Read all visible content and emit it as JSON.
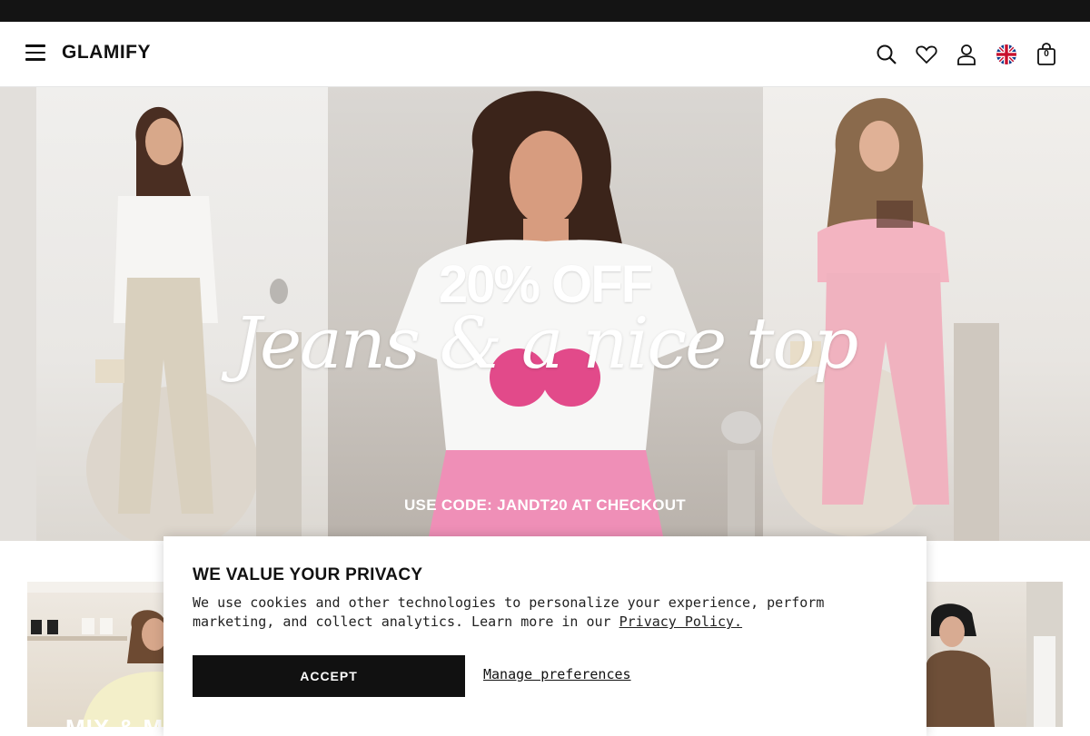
{
  "brand": {
    "name": "GLAMIFY"
  },
  "header": {
    "icons": [
      "menu-icon",
      "search-icon",
      "heart-icon",
      "user-icon",
      "uk-flag-icon",
      "bag-icon"
    ],
    "bag_count": "0"
  },
  "hero": {
    "discount": "20% OFF",
    "headline": "Jeans & a nice top",
    "code_text": "USE CODE: JANDT20 AT CHECKOUT"
  },
  "tiles": {
    "left_text": "MIX & M"
  },
  "cookie": {
    "title": "WE VALUE YOUR PRIVACY",
    "body": "We use cookies and other technologies to personalize your experience, perform marketing, and collect analytics. Learn more in our",
    "link": "Privacy Policy.",
    "accept": "ACCEPT",
    "manage": "Manage preferences"
  },
  "colors": {
    "topbar": "#141414",
    "accent": "#111111"
  }
}
